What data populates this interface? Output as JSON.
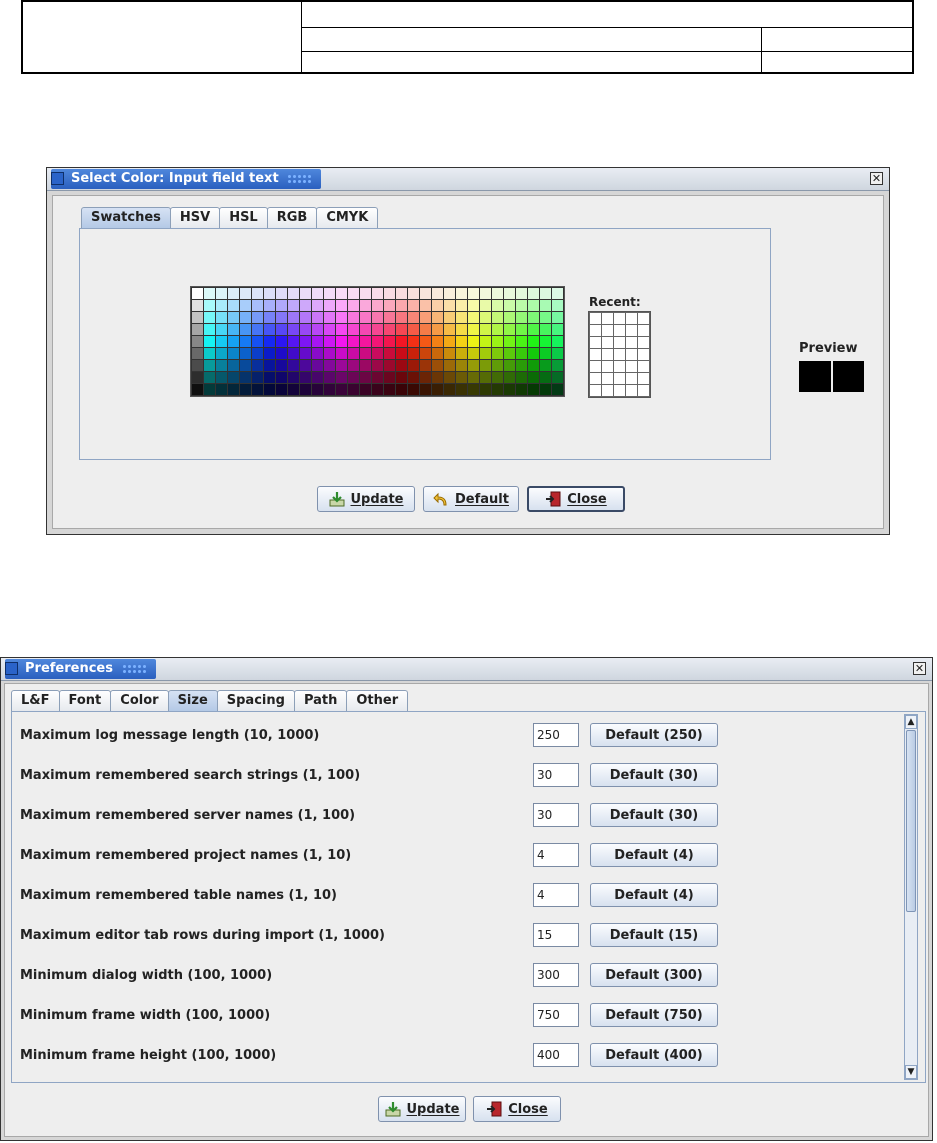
{
  "color_dialog": {
    "title": "Select Color: Input field text",
    "tabs": [
      "Swatches",
      "HSV",
      "HSL",
      "RGB",
      "CMYK"
    ],
    "active_tab": "Swatches",
    "recent_label": "Recent:",
    "preview_label": "Preview",
    "preview_color": "#000000",
    "buttons": [
      {
        "label": "Update",
        "icon": "update-icon"
      },
      {
        "label": "Default",
        "icon": "undo-arrow-icon"
      },
      {
        "label": "Close",
        "icon": "door-exit-icon"
      }
    ]
  },
  "preferences_dialog": {
    "title": "Preferences",
    "tabs": [
      "L&F",
      "Font",
      "Color",
      "Size",
      "Spacing",
      "Path",
      "Other"
    ],
    "active_tab": "Size",
    "rows": [
      {
        "label": "Maximum log message length (10, 1000)",
        "value": "250",
        "default": "Default (250)"
      },
      {
        "label": "Maximum remembered search strings (1, 100)",
        "value": "30",
        "default": "Default (30)"
      },
      {
        "label": "Maximum remembered server names (1, 100)",
        "value": "30",
        "default": "Default (30)"
      },
      {
        "label": "Maximum remembered project names (1, 10)",
        "value": "4",
        "default": "Default (4)"
      },
      {
        "label": "Maximum remembered table names (1, 10)",
        "value": "4",
        "default": "Default (4)"
      },
      {
        "label": "Maximum editor tab rows during import (1, 1000)",
        "value": "15",
        "default": "Default (15)"
      },
      {
        "label": "Minimum dialog width (100, 1000)",
        "value": "300",
        "default": "Default (300)"
      },
      {
        "label": "Minimum frame width (100, 1000)",
        "value": "750",
        "default": "Default (750)"
      },
      {
        "label": "Minimum frame height (100, 1000)",
        "value": "400",
        "default": "Default (400)"
      }
    ],
    "buttons": [
      {
        "label": "Update",
        "icon": "update-icon"
      },
      {
        "label": "Close",
        "icon": "door-exit-icon"
      }
    ]
  }
}
